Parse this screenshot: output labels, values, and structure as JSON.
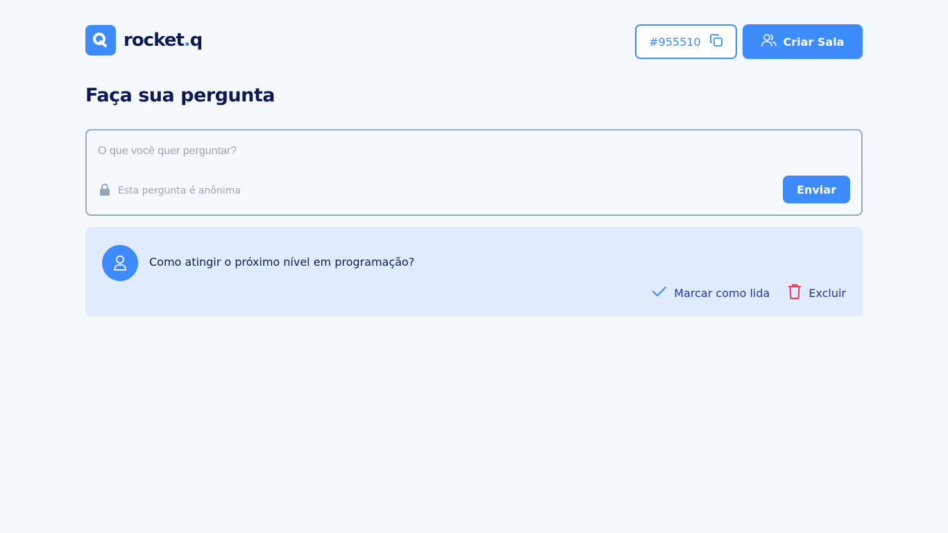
{
  "header": {
    "logo_text_main": "rocket",
    "logo_text_dot": ".",
    "logo_text_end": "q",
    "room_code": "#955510",
    "create_room_label": "Criar Sala"
  },
  "page": {
    "title": "Faça sua pergunta"
  },
  "form": {
    "placeholder": "O que você quer perguntar?",
    "anonymous_note": "Esta pergunta é anônima",
    "submit_label": "Enviar"
  },
  "questions": [
    {
      "text": "Como atingir o próximo nível em programação?",
      "mark_read_label": "Marcar como lida",
      "delete_label": "Excluir"
    }
  ],
  "colors": {
    "primary": "#3d8bfd",
    "heading": "#0d1b52",
    "danger": "#e5375b",
    "card_bg": "#e0ecfd",
    "page_bg": "#f5f8fd"
  }
}
